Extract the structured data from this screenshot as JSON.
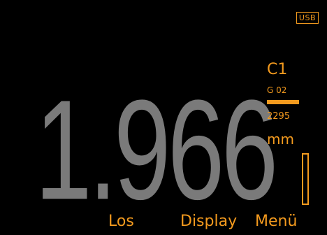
{
  "status": {
    "usb_label": "USB"
  },
  "measurement": {
    "value": "1.966",
    "unit": "mm"
  },
  "side_panel": {
    "channel": "C1",
    "group": "G 02",
    "count": "2295"
  },
  "level_gauge": {
    "fill_fraction": 0.0
  },
  "softkeys": {
    "left_label": "Los",
    "middle_label": "Display",
    "right_label": "Menü"
  },
  "colors": {
    "background": "#000000",
    "accent": "#f39a1e",
    "reading": "#7a7a7a"
  }
}
